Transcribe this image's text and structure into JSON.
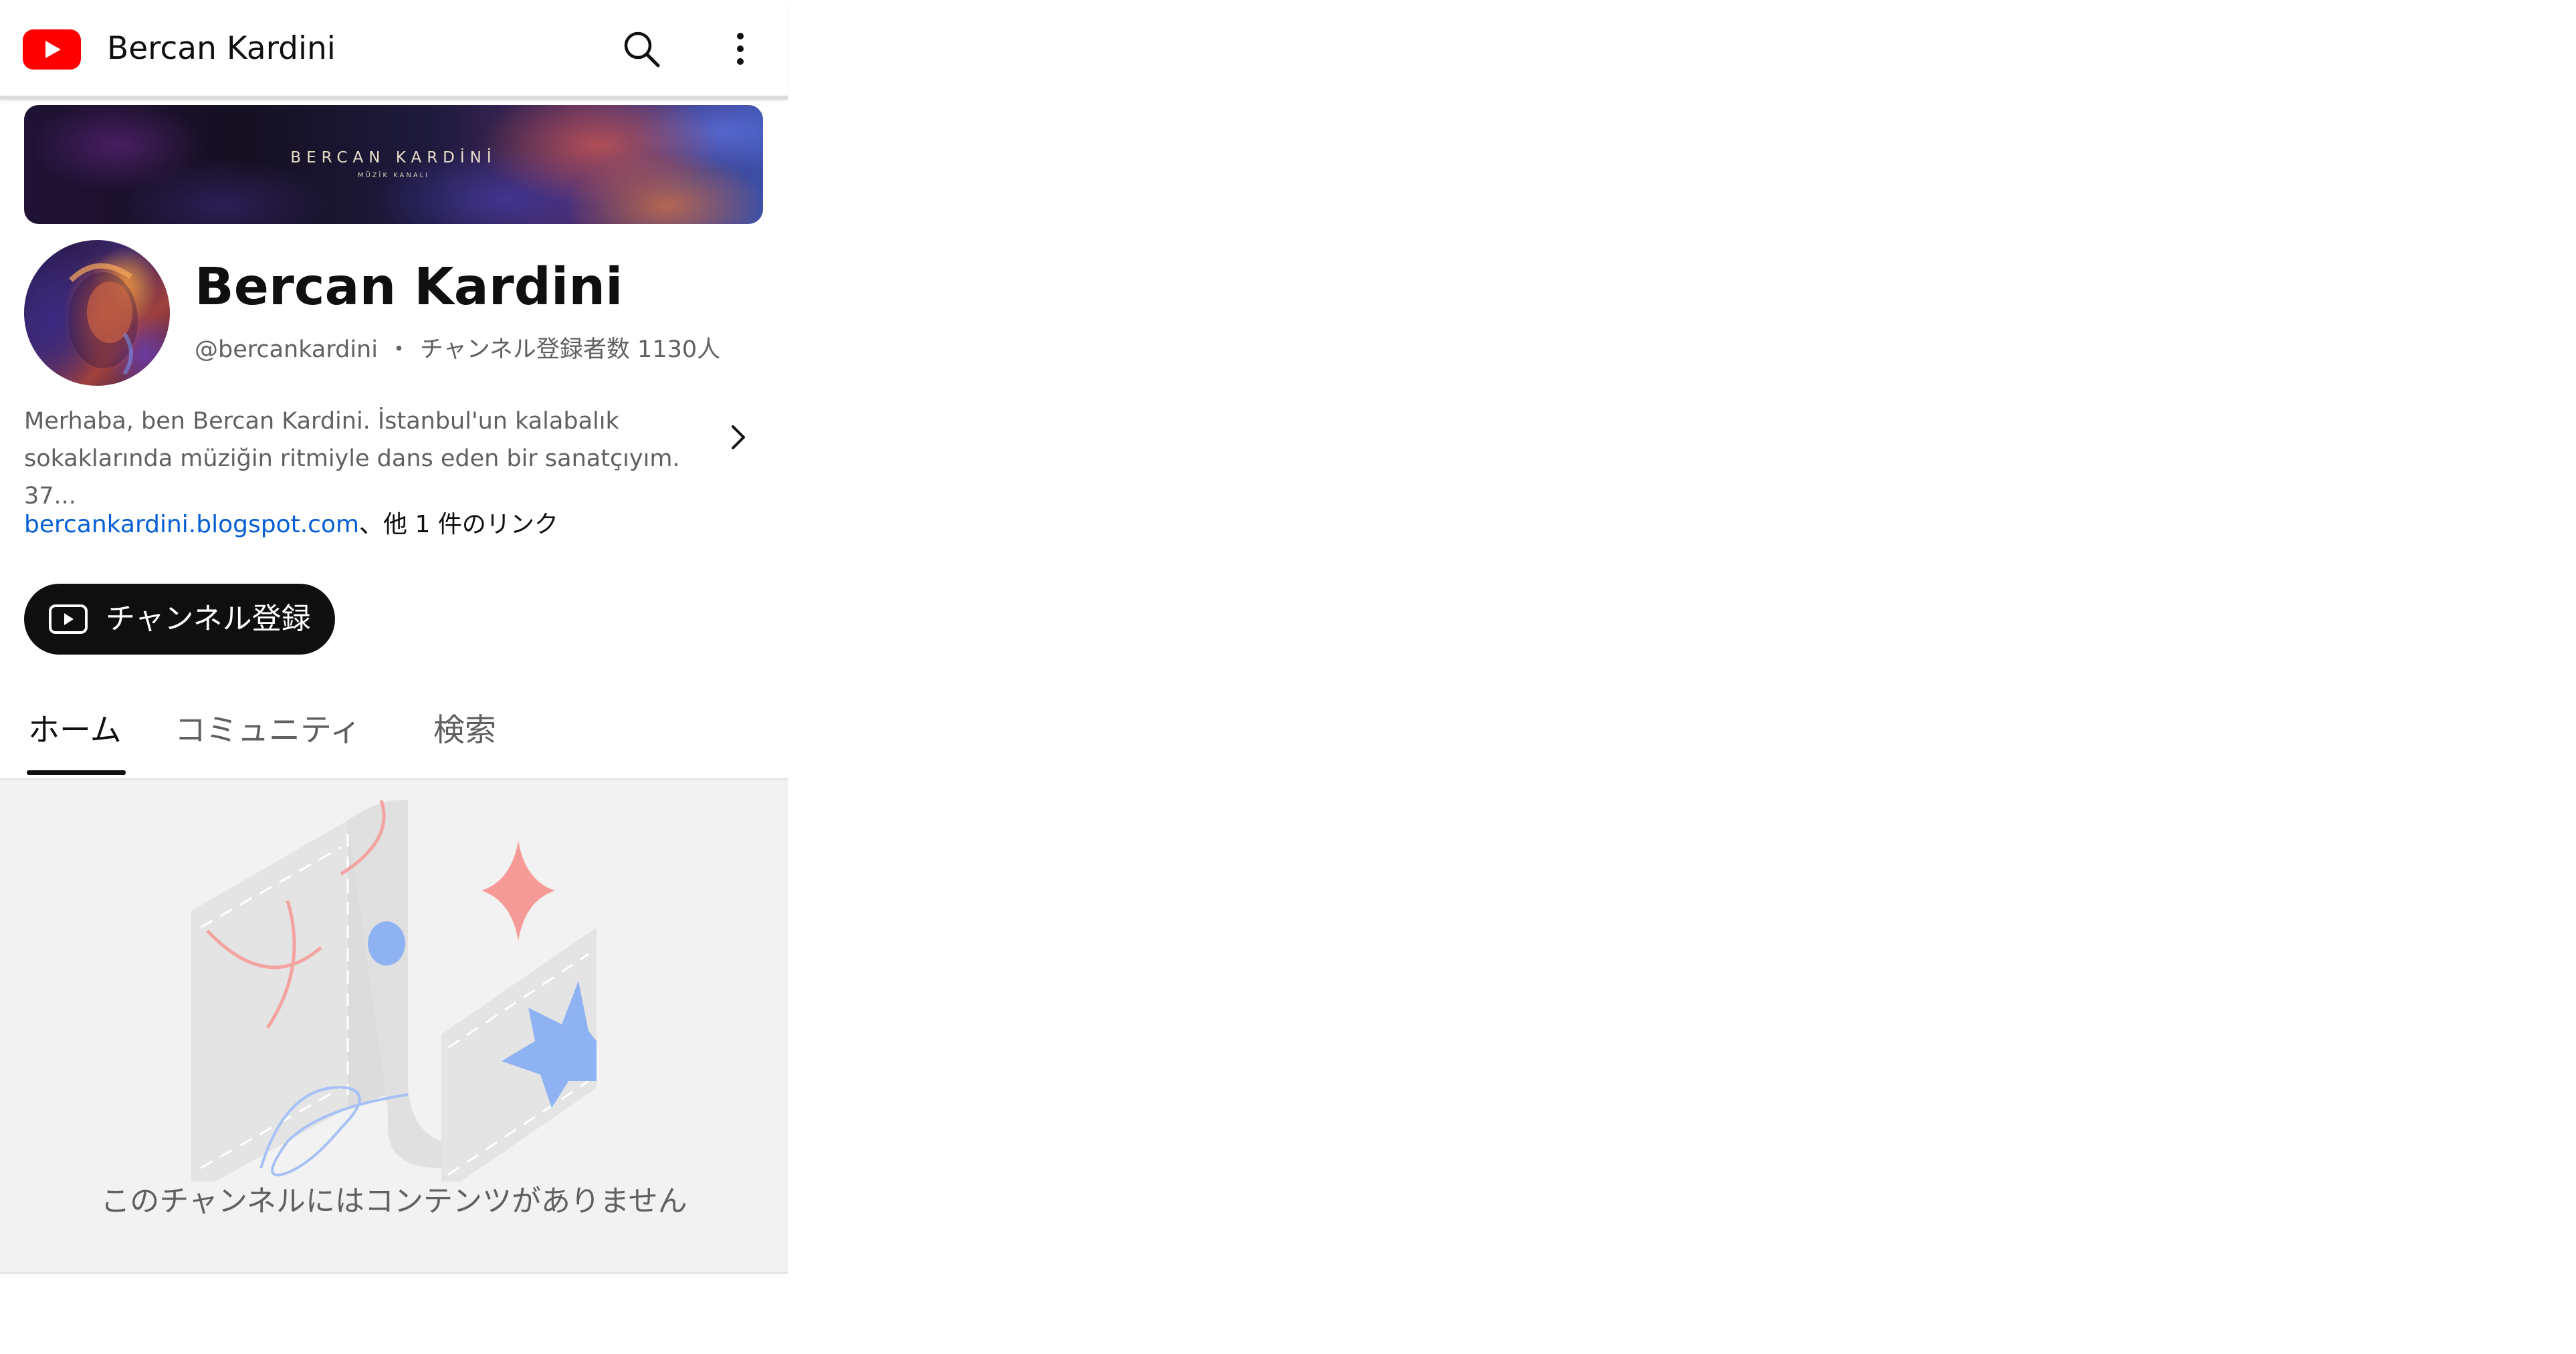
{
  "header": {
    "app_title": "Bercan Kardini",
    "logo_icon": "youtube-logo-icon",
    "search_icon": "search-icon",
    "more_icon": "more-vert-icon"
  },
  "banner": {
    "title": "BERCAN KARDİNİ",
    "subtitle": "MÜZİK KANALI"
  },
  "channel": {
    "name": "Bercan Kardini",
    "handle": "@bercankardini",
    "separator": "・",
    "subscribers": "チャンネル登録者数 1130人",
    "description": "Merhaba, ben Bercan Kardini. İstanbul'un kalabalık sokaklarında müziğin ritmiyle dans eden bir sanatçıyım. 37...",
    "link_url": "bercankardini.blogspot.com",
    "link_more": "、他 1 件のリンク"
  },
  "subscribe": {
    "label": "チャンネル登録",
    "icon": "youtube-play-icon"
  },
  "tabs": [
    {
      "label": "ホーム",
      "active": true
    },
    {
      "label": "コミュニティ",
      "active": false
    },
    {
      "label": "検索",
      "active": false
    }
  ],
  "empty_state": {
    "message": "このチャンネルにはコンテンツがありません",
    "illustration": "empty-channel-illustration"
  },
  "colors": {
    "brand_red": "#ff0000",
    "link_blue": "#065fd4",
    "text_primary": "#0f0f0f",
    "text_secondary": "#606060",
    "button_bg": "#0f0f0f",
    "empty_bg": "#f2f2f2"
  }
}
